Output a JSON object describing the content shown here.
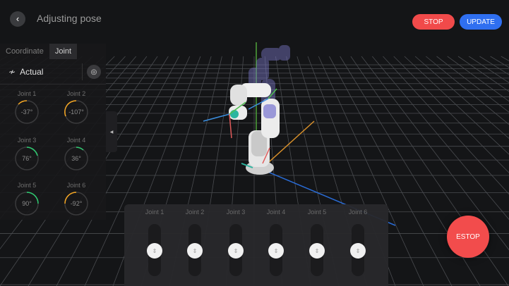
{
  "header": {
    "title": "Adjusting pose",
    "back_icon": "chevron-left-icon",
    "stop_label": "STOP",
    "update_label": "UPDATE"
  },
  "left_panel": {
    "tabs": [
      {
        "label": "Coordinate",
        "active": false
      },
      {
        "label": "Joint",
        "active": true
      }
    ],
    "mode_icon": "signal-wave-icon",
    "mode_label": "Actual",
    "target_icon": "target-icon",
    "joints": [
      {
        "label": "Joint 1",
        "value": "-37°",
        "arc_color": "#f5a623"
      },
      {
        "label": "Joint 2",
        "value": "-107°",
        "arc_color": "#f5a623"
      },
      {
        "label": "Joint 3",
        "value": "76°",
        "arc_color": "#2ecc71"
      },
      {
        "label": "Joint 4",
        "value": "36°",
        "arc_color": "#2ecc71"
      },
      {
        "label": "Joint 5",
        "value": "90°",
        "arc_color": "#2ecc71"
      },
      {
        "label": "Joint 6",
        "value": "-92°",
        "arc_color": "#f5a623"
      }
    ]
  },
  "sliders": [
    {
      "label": "Joint 1"
    },
    {
      "label": "Joint 2"
    },
    {
      "label": "Joint 3"
    },
    {
      "label": "Joint 4"
    },
    {
      "label": "Joint 5"
    },
    {
      "label": "Joint 6"
    }
  ],
  "estop_label": "ESTOP",
  "colors": {
    "stop": "#f14a4a",
    "update": "#2f6ff0",
    "estop": "#f24c4c",
    "arc_orange": "#f5a623",
    "arc_green": "#2ecc71"
  }
}
